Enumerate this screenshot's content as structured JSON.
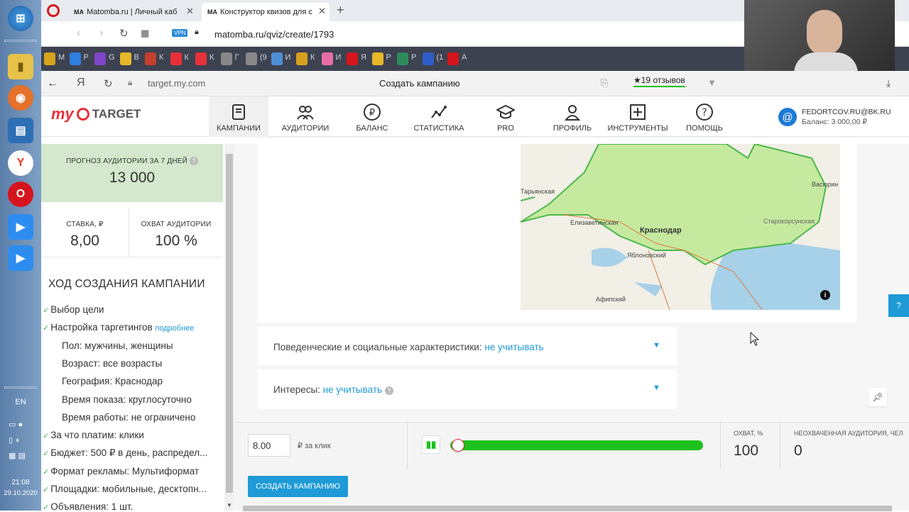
{
  "taskbar": {
    "lang": "EN",
    "time": "21:08",
    "date": "29.10.2020"
  },
  "browser": {
    "tabs": [
      {
        "label": "Matomba.ru | Личный каб"
      },
      {
        "label": "Конструктор квизов для с"
      }
    ],
    "vpn_badge": "VPN",
    "url": "matomba.ru/qviz/create/1793",
    "bookmarks": [
      "M",
      "Р",
      "G",
      "В",
      "К",
      "К",
      "К",
      "Г",
      "(9",
      "И",
      "К",
      "И",
      "Я",
      "Р",
      "Р",
      "(1",
      "А"
    ]
  },
  "ybrowser": {
    "yandex_glyph": "Я",
    "url": "target.my.com",
    "page_title": "Создать кампанию",
    "reviews": "★19 отзывов"
  },
  "mytarget": {
    "logo_my": "my",
    "logo_target": "TARGET",
    "nav": [
      {
        "label": "КАМПАНИИ",
        "icon": "campaigns-icon"
      },
      {
        "label": "АУДИТОРИИ",
        "icon": "audiences-icon"
      },
      {
        "label": "БАЛАНС",
        "icon": "ruble-icon"
      },
      {
        "label": "СТАТИСТИКА",
        "icon": "stats-icon"
      },
      {
        "label": "PRO",
        "icon": "graduation-cap-icon"
      },
      {
        "label": "ПРОФИЛЬ",
        "icon": "profile-icon"
      },
      {
        "label": "ИНСТРУМЕНТЫ",
        "icon": "tools-icon"
      },
      {
        "label": "ПОМОЩЬ",
        "icon": "help-icon"
      }
    ],
    "account_email": "FEDORTCOV.RU@BK.RU",
    "account_balance": "Баланс: 3 000,00 ₽"
  },
  "left": {
    "forecast_label": "ПРОГНОЗ АУДИТОРИИ ЗА 7 ДНЕЙ",
    "forecast_value": "13 000",
    "rate_label": "СТАВКА, ₽",
    "rate_value": "8,00",
    "reach_label": "ОХВАТ АУДИТОРИИ",
    "reach_value": "100 %",
    "progress_title": "ХОД СОЗДАНИЯ КАМПАНИИ",
    "steps": [
      {
        "text": "Выбор цели",
        "check": true
      },
      {
        "text": "Настройка таргетингов",
        "check": true,
        "more": "подробнее"
      },
      {
        "text": "Пол: мужчины, женщины",
        "sub": true
      },
      {
        "text": "Возраст: все возрасты",
        "sub": true
      },
      {
        "text": "География: Краснодар",
        "sub": true
      },
      {
        "text": "Время показа: круглосуточно",
        "sub": true
      },
      {
        "text": "Время работы: не ограничено",
        "sub": true
      },
      {
        "text": "За что платим: клики",
        "check": true
      },
      {
        "text": "Бюджет: 500 ₽ в день, распредел...",
        "check": true
      },
      {
        "text": "Формат рекламы: Мультиформат",
        "check": true
      },
      {
        "text": "Площадки: мобильные, десктопн...",
        "check": true
      },
      {
        "text": "Объявления: 1 шт.",
        "check": true
      }
    ]
  },
  "map": {
    "labels": [
      "Тарьянская",
      "Елизаветинская",
      "Краснодар",
      "Старокорсунская",
      "Яблоновский",
      "Афипский",
      "Васюрин"
    ]
  },
  "sections": [
    {
      "label": "Поведенческие и социальные характеристики:",
      "value": "не учитывать"
    },
    {
      "label": "Интересы:",
      "value": "не учитывать"
    }
  ],
  "bottom": {
    "bid_value": "8.00",
    "bid_unit": "₽ за клик",
    "reach_label": "ОХВАТ, %",
    "reach_value": "100",
    "uncovered_label": "НЕОХВАЧЕННАЯ АУДИТОРИЯ, ЧЕЛ",
    "uncovered_value": "0",
    "slider_level": 1.0,
    "create_button": "СОЗДАТЬ КАМПАНИЮ"
  },
  "help_tab": "?",
  "colors": {
    "accent_blue": "#1e9ad6",
    "forecast_green": "#d3e8cd",
    "slider_green": "#1ec21e",
    "logo_red": "#e8303a"
  }
}
